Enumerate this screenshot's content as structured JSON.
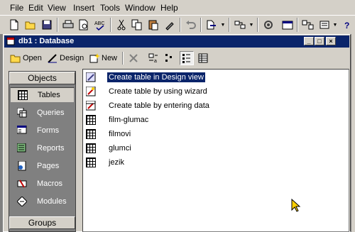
{
  "menubar": {
    "items": [
      "File",
      "Edit",
      "View",
      "Insert",
      "Tools",
      "Window",
      "Help"
    ]
  },
  "toolbar": {
    "icons": [
      "new-icon",
      "open-icon",
      "save-icon",
      "print-icon",
      "print-preview-icon",
      "spelling-icon",
      "cut-icon",
      "copy-icon",
      "paste-icon",
      "format-painter-icon",
      "undo-icon",
      "office-links-icon",
      "analyze-icon",
      "properties-icon",
      "relationships-icon",
      "new-object-icon",
      "help-icon"
    ]
  },
  "window": {
    "title": "db1 : Database",
    "controls": {
      "minimize": "_",
      "maximize": "□",
      "close": "×"
    }
  },
  "db_toolbar": {
    "open": "Open",
    "design": "Design",
    "new": "New"
  },
  "objects_panel": {
    "header": "Objects",
    "items": [
      {
        "label": "Tables",
        "selected": true
      },
      {
        "label": "Queries"
      },
      {
        "label": "Forms"
      },
      {
        "label": "Reports"
      },
      {
        "label": "Pages"
      },
      {
        "label": "Macros"
      },
      {
        "label": "Modules"
      }
    ],
    "groups_header": "Groups"
  },
  "list": {
    "items": [
      {
        "label": "Create table in Design view",
        "icon": "design-view-icon",
        "selected": true
      },
      {
        "label": "Create table by using wizard",
        "icon": "wizard-icon"
      },
      {
        "label": "Create table by entering data",
        "icon": "enter-data-icon"
      },
      {
        "label": "film-glumac",
        "icon": "table-icon"
      },
      {
        "label": "filmovi",
        "icon": "table-icon"
      },
      {
        "label": "glumci",
        "icon": "table-icon"
      },
      {
        "label": "jezik",
        "icon": "table-icon"
      }
    ]
  },
  "colors": {
    "titlebar": "#0a246a",
    "face": "#d4d0c8",
    "shadow": "#808080"
  }
}
